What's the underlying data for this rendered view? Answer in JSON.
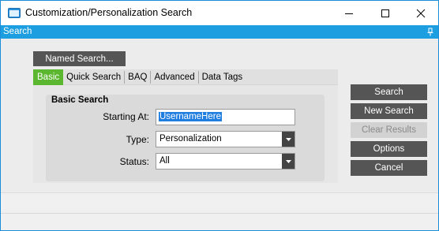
{
  "window": {
    "title": "Customization/Personalization Search",
    "controls": {
      "minimize_icon": "minimize-icon",
      "maximize_icon": "maximize-icon",
      "close_icon": "close-icon"
    }
  },
  "strip": {
    "label": "Search",
    "pin_icon": "pin-icon"
  },
  "named_search_label": "Named Search...",
  "tabs": [
    {
      "label": "Basic",
      "active": true
    },
    {
      "label": "Quick Search",
      "active": false
    },
    {
      "label": "BAQ",
      "active": false
    },
    {
      "label": "Advanced",
      "active": false
    },
    {
      "label": "Data Tags",
      "active": false
    }
  ],
  "basic_search": {
    "title": "Basic Search",
    "starting_at": {
      "label": "Starting At:",
      "value": "UsernameHere"
    },
    "type": {
      "label": "Type:",
      "value": "Personalization"
    },
    "status": {
      "label": "Status:",
      "value": "All"
    }
  },
  "buttons": {
    "search": "Search",
    "new_search": "New Search",
    "clear_results": "Clear Results",
    "options": "Options",
    "cancel": "Cancel"
  },
  "colors": {
    "accent": "#1c9ee0",
    "active_tab": "#5bb630",
    "button": "#555555",
    "selection": "#1f7ee0"
  }
}
